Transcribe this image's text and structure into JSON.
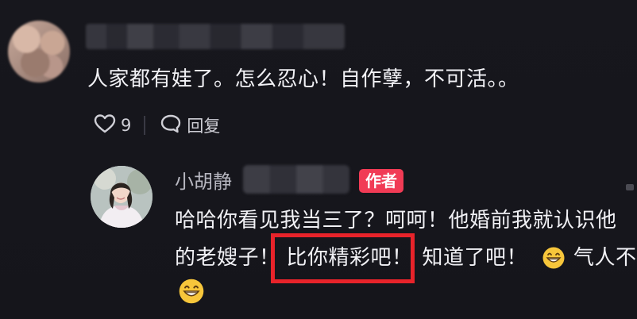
{
  "top_comment": {
    "text": "人家都有娃了。怎么忍心！自作孽，不可活。。",
    "like_count": "9",
    "reply_label": "回复"
  },
  "reply": {
    "username": "小胡静",
    "badge": "作者",
    "line1": "哈哈你看见我当三了？呵呵！他婚前我就认识他",
    "line2_before": "的老嫂子！",
    "line2_highlight": "比你精彩吧！",
    "line2_after": "知道了吧！",
    "line2_tail": "气人不"
  },
  "colors": {
    "background": "#16161c",
    "badge": "#f13b55",
    "highlight_border": "#e8232a",
    "text": "#f1f1f5",
    "muted": "#b7b7c0"
  },
  "icons": {
    "like": "heart-outline-icon",
    "reply": "speech-bubble-icon",
    "emoji": "grinning-emoji-icon"
  }
}
